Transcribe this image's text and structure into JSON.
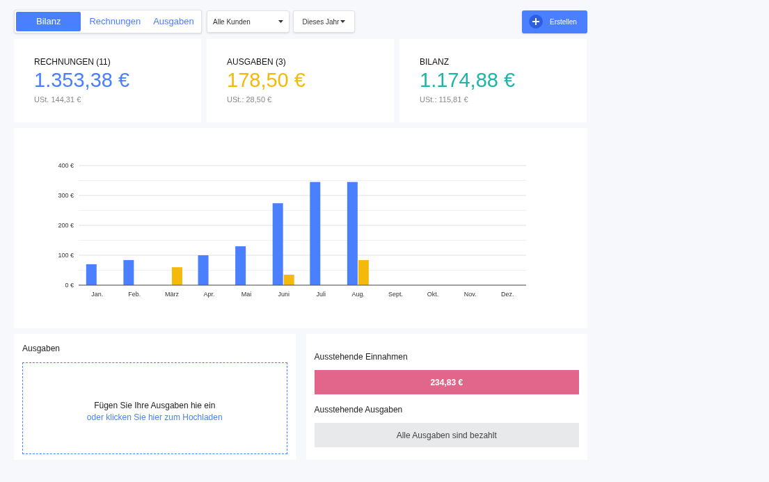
{
  "tabs": [
    {
      "label": "Bilanz",
      "selected": true
    },
    {
      "label": "Rechnungen",
      "selected": false
    },
    {
      "label": "Ausgaben",
      "selected": false
    }
  ],
  "filters": [
    {
      "label": "Alle Kunden"
    },
    {
      "label": "Dieses Jahr"
    }
  ],
  "create_button": {
    "label": "Erstellen"
  },
  "summary_cards": [
    {
      "kind": "invoices",
      "title": "RECHNUNGEN (11)",
      "amount": "1.353,38 €",
      "tax": "USt. 144,31 €"
    },
    {
      "kind": "expenses",
      "title": "AUSGABEN (3)",
      "amount": "178,50 €",
      "tax": "USt.: 28,50 €"
    },
    {
      "kind": "balance",
      "title": "BILANZ",
      "amount": "1.174,88 €",
      "tax": "USt.: 115,81 €"
    }
  ],
  "chart": {
    "chart_data": {
      "type": "bar",
      "categories": [
        "Jan.",
        "Feb.",
        "März",
        "Apr.",
        "Mai",
        "Juni",
        "Juli",
        "Aug.",
        "Sept.",
        "Okt.",
        "Nov.",
        "Dez."
      ],
      "series": [
        {
          "color": "#4a7fff",
          "values": [
            70,
            84,
            0,
            100,
            130,
            274,
            345,
            345,
            0,
            0,
            0,
            0
          ]
        },
        {
          "color": "#f4b90b",
          "values": [
            0,
            0,
            60,
            0,
            0,
            35,
            0,
            84,
            0,
            0,
            0,
            0
          ]
        }
      ],
      "ylim": [
        0,
        400
      ],
      "grid": true,
      "yticks": [
        {
          "value": 0,
          "label": "0 €"
        },
        {
          "value": 100,
          "label": "100 €"
        },
        {
          "value": 200,
          "label": "200 €"
        },
        {
          "value": 300,
          "label": "300 €"
        },
        {
          "value": 400,
          "label": "400 €"
        }
      ]
    }
  },
  "expenses_upload": {
    "title": "Ausgaben",
    "drop_text": "Fügen Sie Ihre Ausgaben hie ein",
    "upload_link": "oder klicken Sie hier zum Hochladen"
  },
  "outstanding": [
    {
      "kind": "due",
      "title": "Ausstehende Einnahmen",
      "value": "234,83 €"
    },
    {
      "kind": "settled",
      "title": "Ausstehende Ausgaben",
      "value": "Alle Ausgaben sind bezahlt"
    }
  ]
}
